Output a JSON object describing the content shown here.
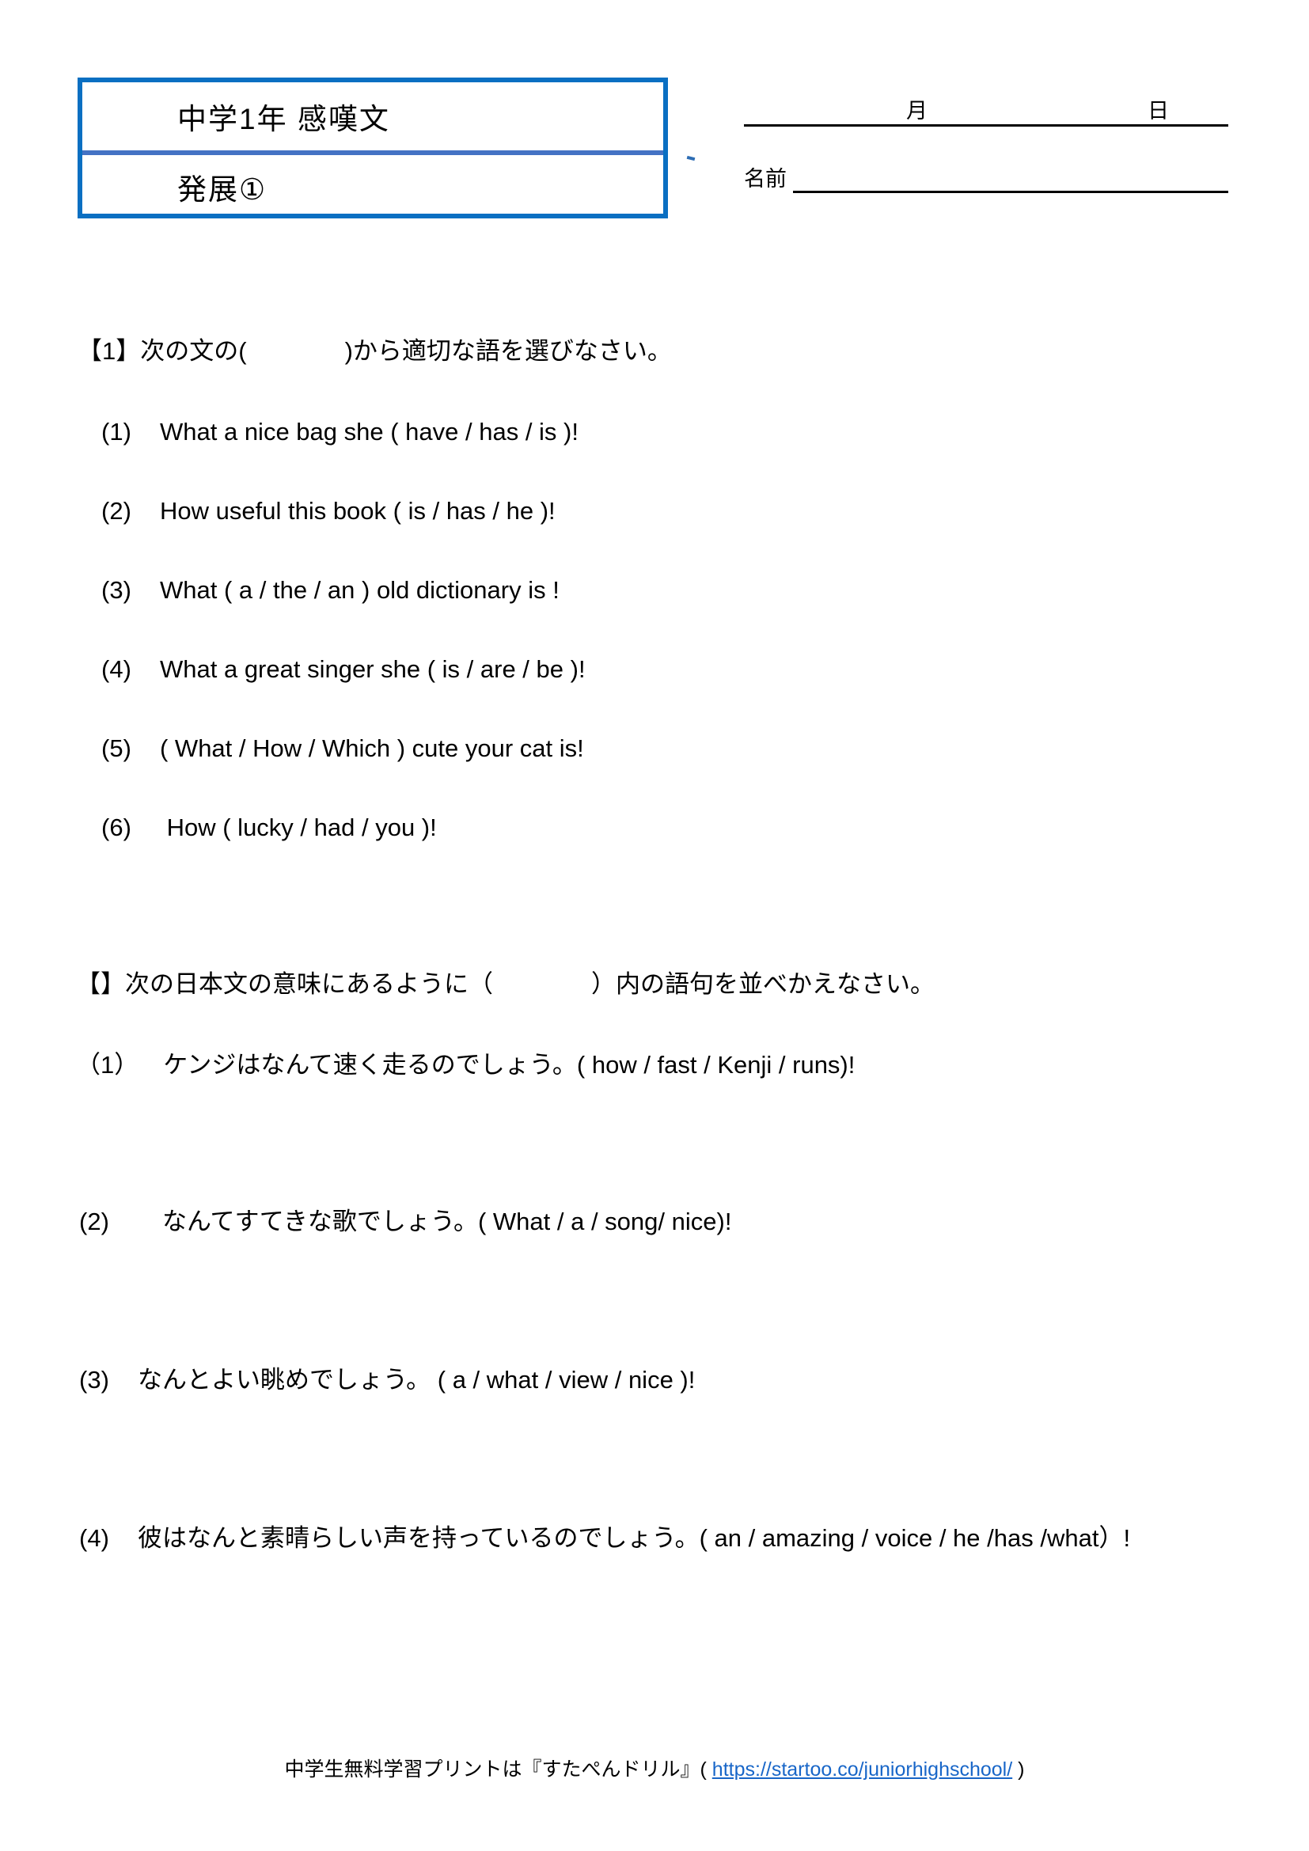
{
  "header": {
    "title_main": "中学1年 感嘆文",
    "title_sub": "発展①",
    "month_label": "月",
    "day_label": "日",
    "name_label": "名前",
    "border_color": "#0a6fc2",
    "divider_color": "#4472c4"
  },
  "section1": {
    "heading": "【1】次の文の(　　　　)から適切な語を選びなさい。",
    "items": [
      {
        "num": "(1)",
        "text": "What a nice bag she (   have   / has   / is    )!"
      },
      {
        "num": "(2)",
        "text": "How useful this book ( is   / has / he )!"
      },
      {
        "num": "(3)",
        "text": "What (   a /    the /   an   ) old dictionary is !"
      },
      {
        "num": "(4)",
        "text": "What a great singer she   ( is   /   are / be )!"
      },
      {
        "num": "(5)",
        "text": "( What / How / Which ) cute your cat is!"
      },
      {
        "num": "(6)",
        "text": " How   ( lucky / had / you   )!"
      }
    ]
  },
  "section2": {
    "heading": "【】次の日本文の意味にあるように（　　　　）内の語句を並べかえなさい。",
    "items": [
      {
        "num": "（1）",
        "text": "　ケンジはなんて速く走るのでしょう。( how / fast / Kenji / runs)!"
      },
      {
        "num": "(2)",
        "text": "　なんてすてきな歌でしょう。( What / a / song/ nice)!"
      },
      {
        "num": "(3)",
        "text": "なんとよい眺めでしょう。 (   a / what / view / nice )!"
      },
      {
        "num": "(4)",
        "text": "彼はなんと素晴らしい声を持っているのでしょう。(  an / amazing / voice / he /has /what）!"
      }
    ]
  },
  "footer": {
    "prefix": "中学生無料学習プリントは『すたぺんドリル』(",
    "url": "https://startoo.co/juniorhighschool/",
    "suffix": ")",
    "url_color": "#1866c8"
  }
}
